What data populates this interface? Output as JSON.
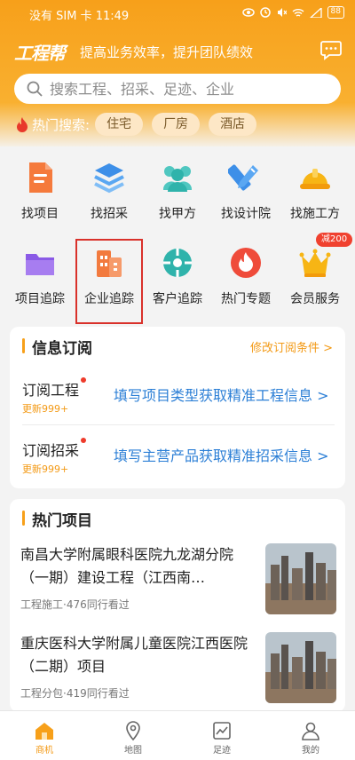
{
  "status": {
    "carrier_time": "没有 SIM 卡 11:49",
    "battery": "88"
  },
  "header": {
    "logo": "工程帮",
    "slogan": "提高业务效率，提升团队绩效"
  },
  "search": {
    "placeholder": "搜索工程、招采、足迹、企业"
  },
  "hot_search": {
    "label": "热门搜索:",
    "chips": [
      "住宅",
      "厂房",
      "酒店"
    ]
  },
  "grid": [
    {
      "label": "找项目",
      "icon": "document-icon"
    },
    {
      "label": "找招采",
      "icon": "layers-icon"
    },
    {
      "label": "找甲方",
      "icon": "group-icon"
    },
    {
      "label": "找设计院",
      "icon": "ruler-pencil-icon"
    },
    {
      "label": "找施工方",
      "icon": "hardhat-icon"
    },
    {
      "label": "项目追踪",
      "icon": "folder-icon"
    },
    {
      "label": "企业追踪",
      "icon": "building-icon"
    },
    {
      "label": "客户追踪",
      "icon": "target-icon"
    },
    {
      "label": "热门专题",
      "icon": "fire-icon"
    },
    {
      "label": "会员服务",
      "icon": "crown-icon"
    }
  ],
  "vip_badge": "减200",
  "subscription": {
    "title": "信息订阅",
    "edit_link": "修改订阅条件 >",
    "rows": [
      {
        "name": "订阅工程",
        "count": "更新999+",
        "action": "填写项目类型获取精准工程信息 >"
      },
      {
        "name": "订阅招采",
        "count": "更新999+",
        "action": "填写主营产品获取精准招采信息 >"
      }
    ]
  },
  "hot_projects": {
    "title": "热门项目",
    "items": [
      {
        "title": "南昌大学附属眼科医院九龙湖分院（一期）建设工程（江西南…",
        "meta": "工程施工·476同行看过"
      },
      {
        "title": "重庆医科大学附属儿童医院江西医院（二期）项目",
        "meta": "工程分包·419同行看过"
      }
    ]
  },
  "bottom_nav": [
    {
      "label": "商机",
      "icon": "house-icon"
    },
    {
      "label": "地图",
      "icon": "map-pin-icon"
    },
    {
      "label": "足迹",
      "icon": "trend-chart-icon"
    },
    {
      "label": "我的",
      "icon": "person-icon"
    }
  ],
  "colors": {
    "primary": "#f7a01a",
    "link": "#2c7fd6",
    "badge": "#f0412f",
    "highlight": "#d9312a"
  }
}
